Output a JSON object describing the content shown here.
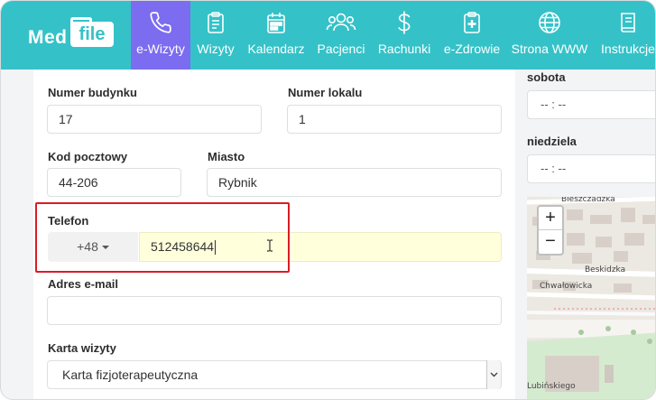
{
  "logo": {
    "part1": "Med",
    "part2": "file"
  },
  "nav": {
    "items": [
      {
        "label": "e-Wizyty",
        "icon": "phone-icon",
        "active": true
      },
      {
        "label": "Wizyty",
        "icon": "clipboard-icon"
      },
      {
        "label": "Kalendarz",
        "icon": "calendar-icon"
      },
      {
        "label": "Pacjenci",
        "icon": "users-icon"
      },
      {
        "label": "Rachunki",
        "icon": "dollar-icon"
      },
      {
        "label": "e-Zdrowie",
        "icon": "medical-clipboard-icon"
      },
      {
        "label": "Strona WWW",
        "icon": "globe-icon"
      },
      {
        "label": "Instrukcje",
        "icon": "book-icon"
      }
    ]
  },
  "form": {
    "building_number": {
      "label": "Numer budynku",
      "value": "17"
    },
    "unit_number": {
      "label": "Numer lokalu",
      "value": "1"
    },
    "postal_code": {
      "label": "Kod pocztowy",
      "value": "44-206"
    },
    "city": {
      "label": "Miasto",
      "value": "Rybnik"
    },
    "phone": {
      "label": "Telefon",
      "country_code": "+48",
      "value": "512458644"
    },
    "email": {
      "label": "Adres e-mail",
      "value": ""
    },
    "visit_card": {
      "label": "Karta wizyty",
      "value": "Karta fizjoterapeutyczna"
    }
  },
  "schedule": {
    "saturday": {
      "label": "sobota",
      "value": "-- : --"
    },
    "sunday": {
      "label": "niedziela",
      "value": "-- : --"
    }
  },
  "map": {
    "zoom_in": "+",
    "zoom_out": "−",
    "streets": [
      "Bieszczadzka",
      "Beskidzka",
      "Chwałowicka",
      "Lubińskiego"
    ]
  },
  "colors": {
    "nav_bg": "#34c2c8",
    "nav_active": "#7c6cf0",
    "highlight_box": "#d81e26",
    "phone_field_bg": "#ffffdc"
  }
}
